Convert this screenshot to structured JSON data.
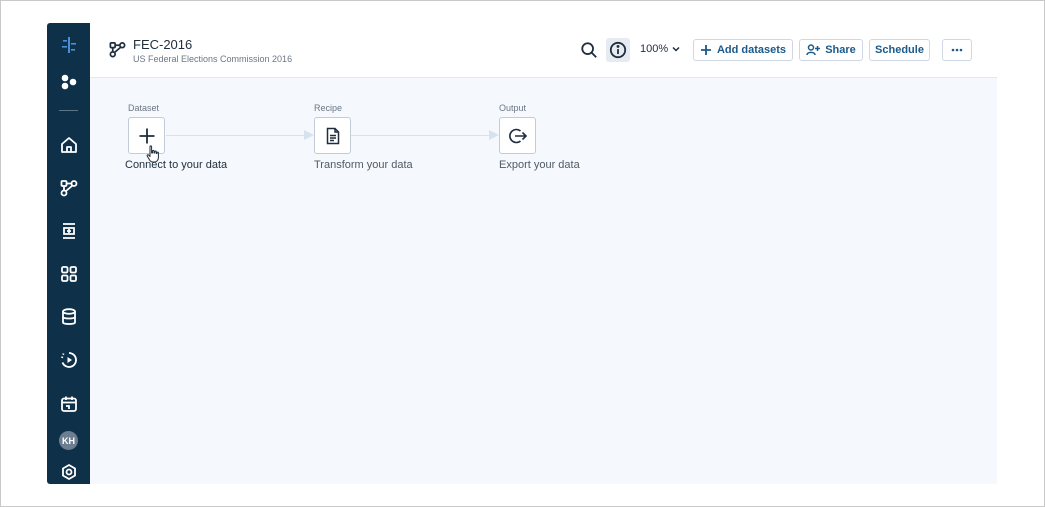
{
  "project": {
    "title": "FEC-2016",
    "subtitle": "US Federal Elections Commission 2016"
  },
  "toolbar": {
    "zoom_label": "100%",
    "add_datasets_label": "Add datasets",
    "share_label": "Share",
    "schedule_label": "Schedule"
  },
  "sidebar": {
    "items": [
      {
        "name": "logo-icon"
      },
      {
        "name": "nodes-icon"
      },
      {
        "name": "home-icon"
      },
      {
        "name": "flows-icon"
      },
      {
        "name": "recipe-icon"
      },
      {
        "name": "apps-grid-icon"
      },
      {
        "name": "database-icon"
      },
      {
        "name": "jobs-icon"
      },
      {
        "name": "schedule-icon"
      }
    ],
    "avatar_initials": "KH"
  },
  "canvas": {
    "steps": [
      {
        "label": "Dataset",
        "caption": "Connect to your data",
        "icon": "plus-icon"
      },
      {
        "label": "Recipe",
        "caption": "Transform your data",
        "icon": "document-icon"
      },
      {
        "label": "Output",
        "caption": "Export your data",
        "icon": "export-icon"
      }
    ]
  },
  "colors": {
    "sidebar": "#0e3049",
    "accent": "#1c5a8a",
    "canvas": "#f5f8fc",
    "connector": "#d6e2ef"
  }
}
